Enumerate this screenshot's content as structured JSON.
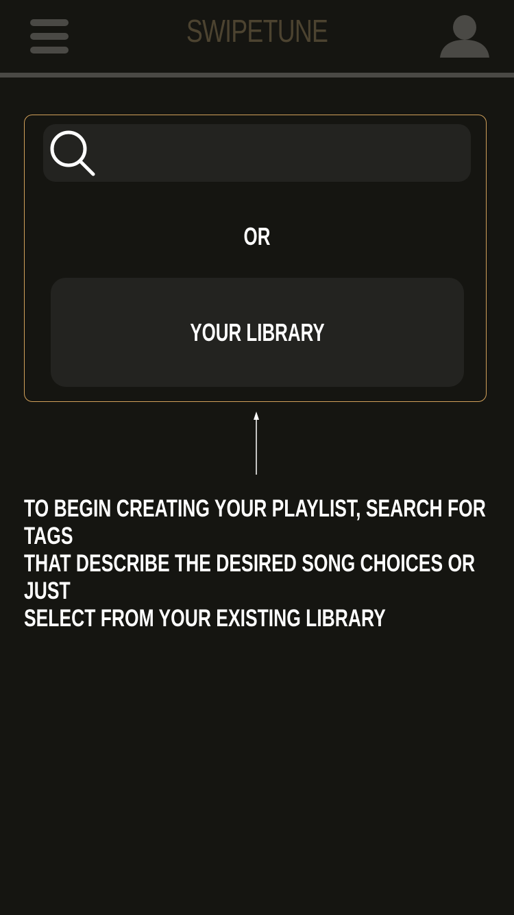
{
  "header": {
    "title": "SWIPETUNE",
    "menu_icon": "hamburger-menu-icon",
    "profile_icon": "user-profile-icon"
  },
  "search": {
    "icon": "magnifier-icon",
    "placeholder": "",
    "value": ""
  },
  "divider_text": "OR",
  "library_button": {
    "label": "YOUR LIBRARY"
  },
  "hint_arrow_icon": "arrow-up-icon",
  "instructions": "TO BEGIN CREATING YOUR PLAYLIST, SEARCH FOR TAGS\nTHAT DESCRIBE THE DESIRED SONG CHOICES OR JUST\nSELECT FROM YOUR EXISTING LIBRARY",
  "colors": {
    "background": "#151511",
    "panel_border": "#d2a15a",
    "control_fill": "#232320",
    "header_gray": "#4a4945",
    "title_brown": "#4c4330",
    "text": "#ffffff"
  }
}
